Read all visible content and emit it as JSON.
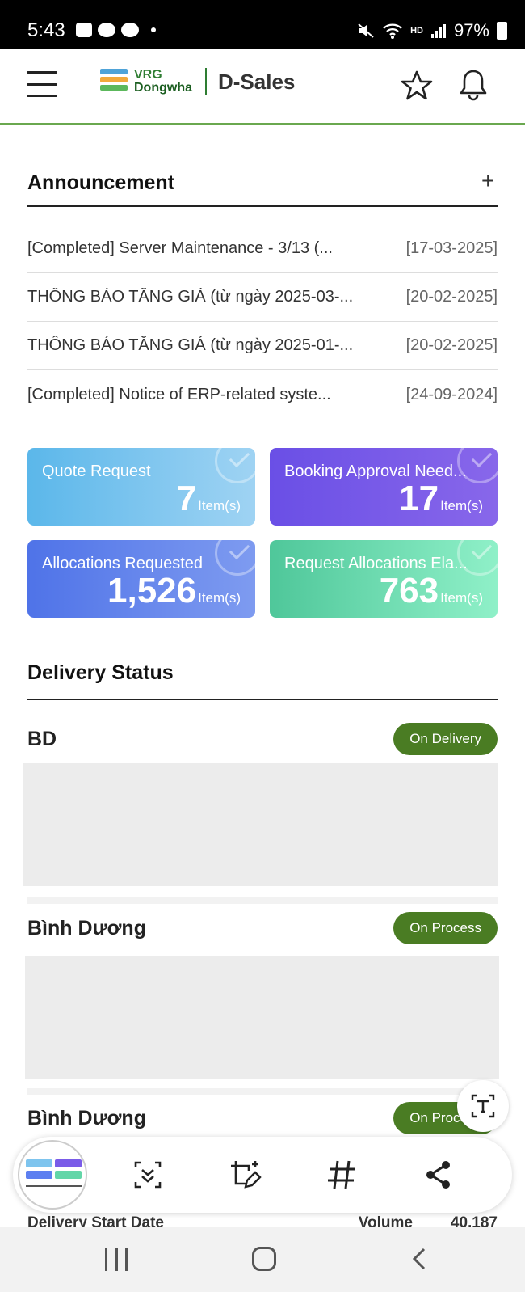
{
  "status_bar": {
    "time": "5:43",
    "battery": "97%",
    "hd_label": "HD"
  },
  "header": {
    "brand_line1": "VRG",
    "brand_line2": "Dongwha",
    "app_name": "D-Sales"
  },
  "announcement": {
    "title": "Announcement",
    "add_label": "+",
    "items": [
      {
        "title": "[Completed] Server Maintenance - 3/13 (...",
        "date": "[17-03-2025]"
      },
      {
        "title": "THÔNG BÁO TĂNG GIÁ (từ ngày 2025-03-...",
        "date": "[20-02-2025]"
      },
      {
        "title": "THÔNG BÁO TĂNG GIÁ (từ ngày 2025-01-...",
        "date": "[20-02-2025]"
      },
      {
        "title": "[Completed] Notice of ERP-related syste...",
        "date": "[24-09-2024]"
      }
    ]
  },
  "cards": [
    {
      "label": "Quote Request",
      "value": "7",
      "unit": "Item(s)"
    },
    {
      "label": "Booking Approval Need...",
      "value": "17",
      "unit": "Item(s)"
    },
    {
      "label": "Allocations Requested",
      "value": "1,526",
      "unit": "Item(s)"
    },
    {
      "label": "Request Allocations Ela...",
      "value": "763",
      "unit": "Item(s)"
    }
  ],
  "delivery": {
    "title": "Delivery Status",
    "items": [
      {
        "name": "BD",
        "status": "On Delivery"
      },
      {
        "name": "Bình Dương",
        "status": "On Process"
      },
      {
        "name": "Bình Dương",
        "status": "On Process"
      }
    ],
    "footer": {
      "start_label": "Delivery Start Date",
      "volume_label": "Volume",
      "volume_value": "40,187"
    }
  },
  "colors": {
    "brand_green": "#4a7c23",
    "header_rule": "#6aa84f",
    "card_quote": "#5bb7ea",
    "card_booking": "#6a4fe6",
    "card_alloc": "#4f73e8",
    "card_elapsed": "#4fc79a"
  },
  "icons": [
    "menu-icon",
    "star-icon",
    "bell-icon",
    "check-circle-icon",
    "scroll-capture-icon",
    "draw-crop-icon",
    "hashtag-icon",
    "share-icon",
    "text-extract-icon"
  ]
}
